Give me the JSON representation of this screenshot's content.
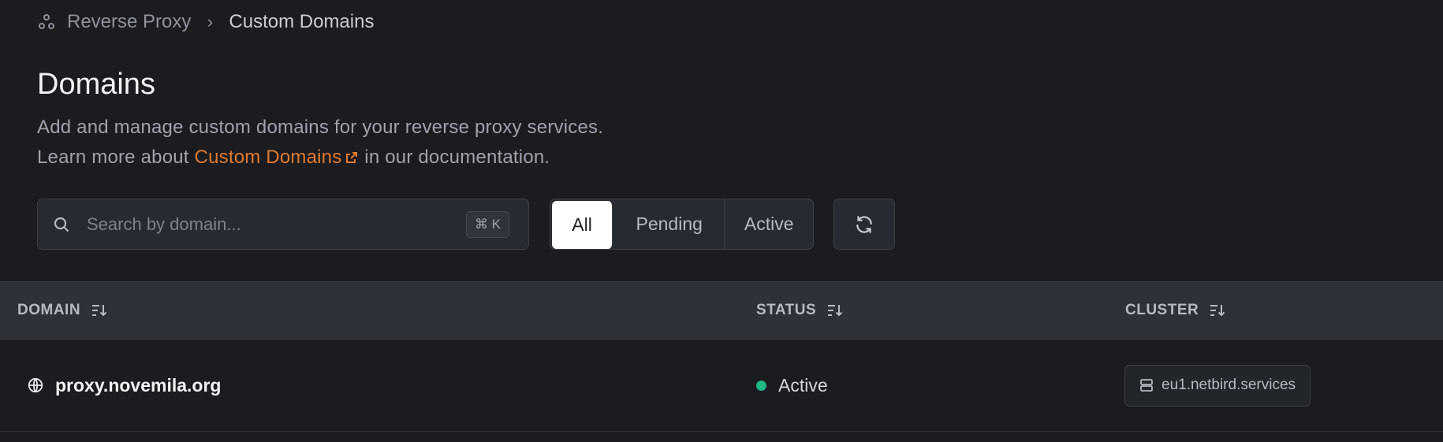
{
  "breadcrumb": {
    "root": "Reverse Proxy",
    "current": "Custom Domains",
    "root_icon": "proxy-icon"
  },
  "header": {
    "title": "Domains",
    "description": "Add and manage custom domains for your reverse proxy services.",
    "learn_prefix": "Learn more about",
    "learn_link": "Custom Domains",
    "learn_suffix": "in our documentation."
  },
  "search": {
    "placeholder": "Search by domain...",
    "value": "",
    "shortcut": "⌘ K"
  },
  "filters": [
    {
      "label": "All",
      "active": true
    },
    {
      "label": "Pending"
    },
    {
      "label": "Active"
    }
  ],
  "table": {
    "columns": [
      "DOMAIN",
      "STATUS",
      "CLUSTER"
    ],
    "rows": [
      {
        "domain": "proxy.novemila.org",
        "status": "Active",
        "cluster": "eu1.netbird.services"
      }
    ]
  },
  "colors": {
    "accent": "#e07a2e",
    "status_active": "#1fb784",
    "background": "#1b1c20"
  }
}
